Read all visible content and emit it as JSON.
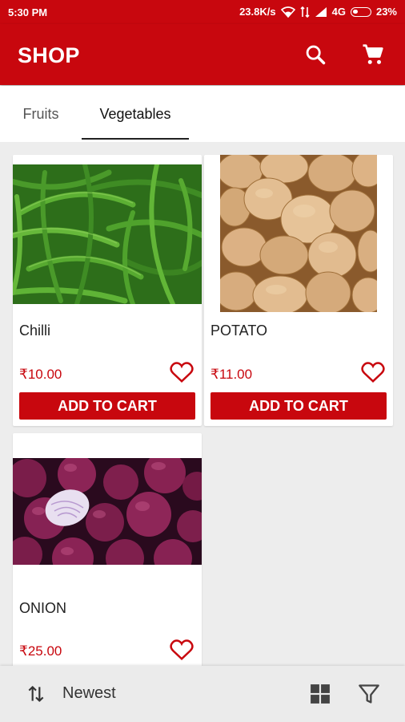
{
  "status_bar": {
    "time": "5:30 PM",
    "network_speed": "23.8K/s",
    "network_type": "4G",
    "battery": "23%",
    "battery_level": 0.23,
    "icons": [
      "wifi-icon",
      "data-icon",
      "signal-icon",
      "battery-icon"
    ]
  },
  "app_bar": {
    "title": "SHOP",
    "icons": [
      "search-icon",
      "cart-icon"
    ],
    "color": "#c8070e"
  },
  "tabs": [
    {
      "label": "Fruits",
      "active": false
    },
    {
      "label": "Vegetables",
      "active": true
    }
  ],
  "products": [
    {
      "name": "Chilli",
      "price": "₹10.00",
      "button": "ADD TO CART",
      "image": "green chilli peppers"
    },
    {
      "name": "POTATO",
      "price": "₹11.00",
      "button": "ADD TO CART",
      "image": "potatoes"
    },
    {
      "name": "ONION",
      "price": "₹25.00",
      "image": "red onions"
    }
  ],
  "bottom_bar": {
    "sort_label": "Newest",
    "icons": [
      "sort-icon",
      "grid-icon",
      "filter-icon"
    ]
  }
}
